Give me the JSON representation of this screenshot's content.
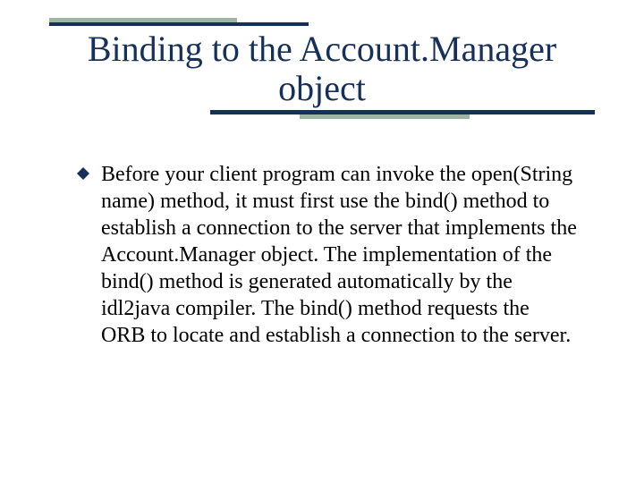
{
  "slide": {
    "title_line1": "Binding to the Account.Manager",
    "title_line2": "object"
  },
  "bullet": {
    "text": "Before your client program can invoke the open(String name) method, it must first use the bind() method to establish a connection to the server that implements the Account.Manager object. The implementation of the bind() method is generated automatically by the idl2java compiler. The bind() method requests the ORB to locate and establish a connection to the server."
  },
  "colors": {
    "accent": "#9db5a3",
    "title": "#15305a",
    "text": "#000000",
    "background": "#ffffff"
  }
}
